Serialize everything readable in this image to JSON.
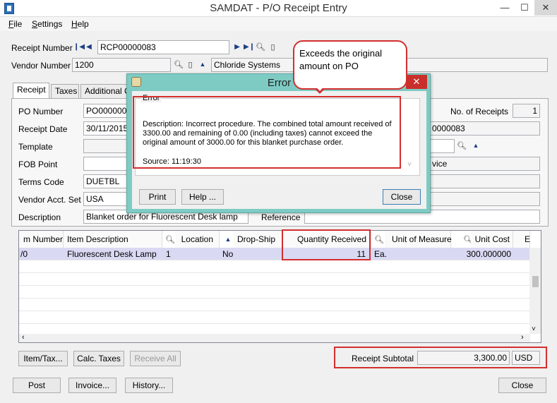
{
  "window": {
    "title": "SAMDAT - P/O Receipt Entry",
    "minimize": "—",
    "maximize": "☐",
    "close": "✕"
  },
  "menu": [
    "File",
    "Settings",
    "Help"
  ],
  "header": {
    "receipt_number_label": "Receipt Number",
    "receipt_number": "RCP00000083",
    "vendor_number_label": "Vendor Number",
    "vendor_number": "1200",
    "vendor_name": "Chloride Systems"
  },
  "tabs": [
    "Receipt",
    "Taxes",
    "Additional Co"
  ],
  "form": {
    "po_number_label": "PO Number",
    "po_number": "PO000000",
    "receipt_date_label": "Receipt Date",
    "receipt_date": "30/11/2015",
    "template_label": "Template",
    "fob_point_label": "FOB Point",
    "terms_code_label": "Terms Code",
    "terms_code": "DUETBL",
    "vendor_acct_set_label": "Vendor Acct. Set",
    "vendor_acct_set": "USA",
    "description_label": "Description",
    "description": "Blanket order for Fluorescent Desk lamp",
    "reference_label": "Reference",
    "no_of_receipts_label": "No. of Receipts",
    "no_of_receipts": "1",
    "right_field_1": "0000083",
    "right_field_2": "vice"
  },
  "grid": {
    "columns": [
      "m Number",
      "Item Description",
      "Location",
      "Drop-Ship",
      "Quantity Received",
      "Unit of Measure",
      "Unit Cost",
      "E"
    ],
    "row": {
      "item_number": "/0",
      "item_description": "Fluorescent Desk Lamp",
      "location": "1",
      "drop_ship": "No",
      "quantity_received": "11",
      "unit_of_measure": "Ea.",
      "unit_cost": "300.000000"
    }
  },
  "buttons": {
    "item_tax": "Item/Tax...",
    "calc_taxes": "Calc. Taxes",
    "receive_all": "Receive All",
    "post": "Post",
    "invoice": "Invoice...",
    "history": "History...",
    "close": "Close"
  },
  "subtotal": {
    "label": "Receipt Subtotal",
    "value": "3,300.00",
    "currency": "USD"
  },
  "dialog": {
    "title": "Error",
    "group_label": "Error",
    "description": "Description: Incorrect procedure. The combined total amount received of 3300.00 and remaining of 0.00 (including taxes) cannot exceed the original amount of 3000.00 for this blanket purchase order.",
    "source": "Source:  11:19:30",
    "print": "Print",
    "help": "Help ...",
    "close": "Close",
    "close_x": "✕"
  },
  "callout": {
    "text": "Exceeds the original amount on PO"
  },
  "colors": {
    "annotation_red": "#d32f2f",
    "dialog_frame": "#7ecbc4",
    "selected_row": "#d9d9f3"
  }
}
